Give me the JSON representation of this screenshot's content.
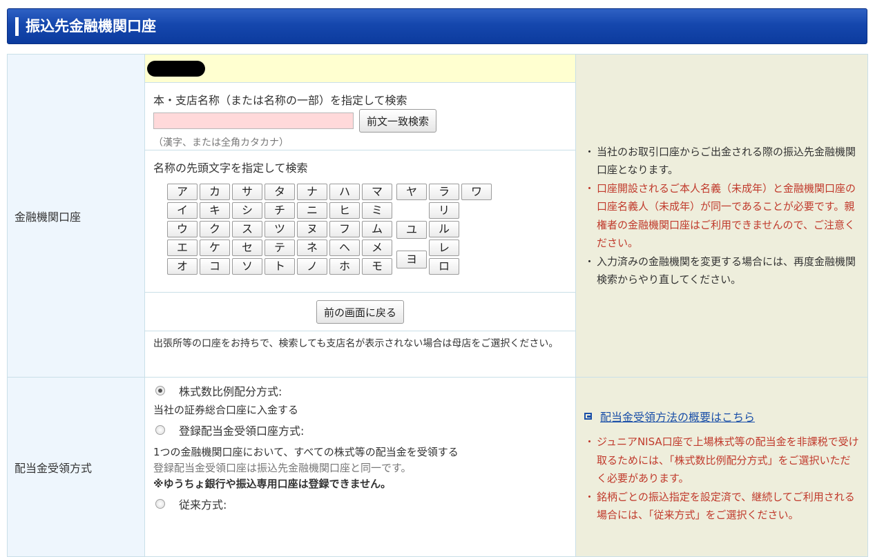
{
  "page_title": "振込先金融機関口座",
  "bank_account": {
    "label": "金融機関口座",
    "search_title": "本・支店名称（または名称の一部）を指定して検索",
    "search_placeholder": "",
    "search_button": "前文一致検索",
    "search_hint": "（漢字、または全角カタカナ）",
    "initial_title": "名称の先頭文字を指定して検索",
    "kana": [
      [
        "ア",
        "イ",
        "ウ",
        "エ",
        "オ"
      ],
      [
        "カ",
        "キ",
        "ク",
        "ケ",
        "コ"
      ],
      [
        "サ",
        "シ",
        "ス",
        "セ",
        "ソ"
      ],
      [
        "タ",
        "チ",
        "ツ",
        "テ",
        "ト"
      ],
      [
        "ナ",
        "ニ",
        "ヌ",
        "ネ",
        "ノ"
      ],
      [
        "ハ",
        "ヒ",
        "フ",
        "ヘ",
        "ホ"
      ],
      [
        "マ",
        "ミ",
        "ム",
        "メ",
        "モ"
      ],
      [
        "ヤ",
        "ユ",
        "ヨ"
      ],
      [
        "ラ",
        "リ",
        "ル",
        "レ",
        "ロ"
      ],
      [
        "ワ"
      ]
    ],
    "back_button": "前の画面に戻る",
    "branch_note": "出張所等の口座をお持ちで、検索しても支店名が表示されない場合は母店をご選択ください。",
    "notes": [
      {
        "text": "当社のお取引口座からご出金される際の振込先金融機関口座となります。",
        "red": false
      },
      {
        "text": "口座開設されるご本人名義（未成年）と金融機関口座の口座名義人（未成年）が同一であることが必要です。親権者の金融機関口座はご利用できませんので、ご注意ください。",
        "red": true
      },
      {
        "text": "入力済みの金融機関を変更する場合には、再度金融機関検索からやり直してください。",
        "red": false
      }
    ]
  },
  "dividend": {
    "label": "配当金受領方式",
    "option1_label": "株式数比例配分方式:",
    "option1_desc": "当社の証券総合口座に入金する",
    "option2_label": "登録配当金受領口座方式:",
    "option2_desc": "1つの金融機関口座において、すべての株式等の配当金を受領する",
    "option2_desc2": "登録配当金受領口座は振込先金融機関口座と同一です。",
    "option2_warning": "※ゆうちょ銀行や振込専用口座は登録できません。",
    "option3_label": "従来方式:",
    "link_text": "配当金受領方法の概要はこちら",
    "notes": [
      {
        "text": "ジュニアNISA口座で上場株式等の配当金を非課税で受け取るためには、「株式数比例配分方式」をご選択いただく必要があります。",
        "red": true
      },
      {
        "text": "銘柄ごとの振込指定を設定済で、継続してご利用される場合には、「従来方式」をご選択ください。",
        "red": true
      }
    ]
  },
  "colors": {
    "header": "#1547ad",
    "note_bg": "#eeeedc",
    "label_bg": "#eef6fd",
    "red": "#c0392b",
    "highlight": "#ffffd0",
    "input_bg": "#ffd9da"
  }
}
